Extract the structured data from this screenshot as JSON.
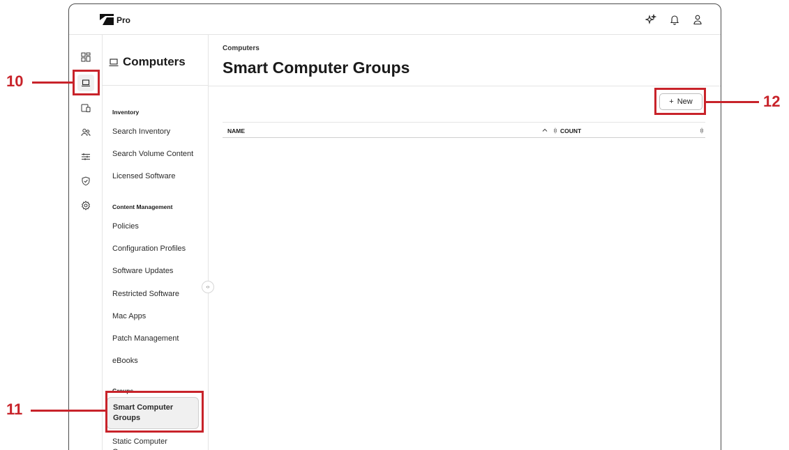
{
  "app": {
    "brand": "Pro"
  },
  "topbar": {
    "icons": [
      "sparkles-icon",
      "bell-icon",
      "user-icon"
    ]
  },
  "rail": {
    "icons": [
      "dashboard-icon",
      "laptop-icon",
      "devices-icon",
      "users-icon",
      "sliders-icon",
      "shield-icon",
      "gear-icon"
    ],
    "active": "laptop-icon"
  },
  "subnav": {
    "title": "Computers",
    "sections": [
      {
        "label": "Inventory",
        "items": [
          "Search Inventory",
          "Search Volume Content",
          "Licensed Software"
        ]
      },
      {
        "label": "Content Management",
        "items": [
          "Policies",
          "Configuration Profiles",
          "Software Updates",
          "Restricted Software",
          "Mac Apps",
          "Patch Management",
          "eBooks"
        ]
      },
      {
        "label": "Groups",
        "items": [
          "Smart Computer Groups",
          "Static Computer Groups"
        ]
      }
    ],
    "active_item": "Smart Computer Groups",
    "collapse_glyph": "‹›"
  },
  "main": {
    "breadcrumb": "Computers",
    "title": "Smart Computer Groups",
    "new_button": {
      "icon": "+",
      "label": "New"
    },
    "table": {
      "columns": [
        "NAME",
        "COUNT"
      ],
      "rows": []
    }
  },
  "callouts": [
    "10",
    "11",
    "12"
  ],
  "colors": {
    "callout": "#c8232a",
    "active_bg": "#f0f0f0"
  }
}
